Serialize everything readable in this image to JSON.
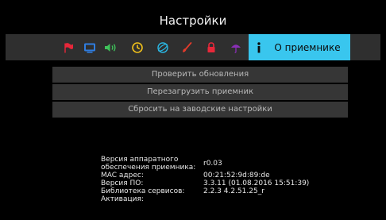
{
  "header": {
    "title": "Настройки"
  },
  "tabs": {
    "icons": [
      {
        "name": "flag-icon",
        "color": "#e8273a"
      },
      {
        "name": "monitor-icon",
        "color": "#2f7de0"
      },
      {
        "name": "speaker-icon",
        "color": "#3fc25a"
      },
      {
        "name": "clock-icon",
        "color": "#f2c21b"
      },
      {
        "name": "globe-icon",
        "color": "#2ab7e3"
      },
      {
        "name": "brush-icon",
        "color": "#e23b2b"
      },
      {
        "name": "lock-icon",
        "color": "#e8283a"
      },
      {
        "name": "umbrella-icon",
        "color": "#8a2fb6"
      }
    ],
    "active_label": "О приемнике",
    "active_color": "#39c6ee"
  },
  "menu": {
    "items": [
      "Проверить обновления",
      "Перезагрузить приемник",
      "Сбросить на заводские настройки"
    ]
  },
  "info": {
    "rows": [
      {
        "label": "Версия аппаратного обеспечения приемника:",
        "value": "r0.03"
      },
      {
        "label": "MAC адрес:",
        "value": "00:21:52:9d:89:de"
      },
      {
        "label": "Версия ПО:",
        "value": "3.3.11 (01.08.2016 15:51:39)"
      },
      {
        "label": "Библиотека сервисов:",
        "value": "2.2.3 4.2.51.25_r"
      },
      {
        "label": "Активация:",
        "value": ""
      }
    ]
  }
}
